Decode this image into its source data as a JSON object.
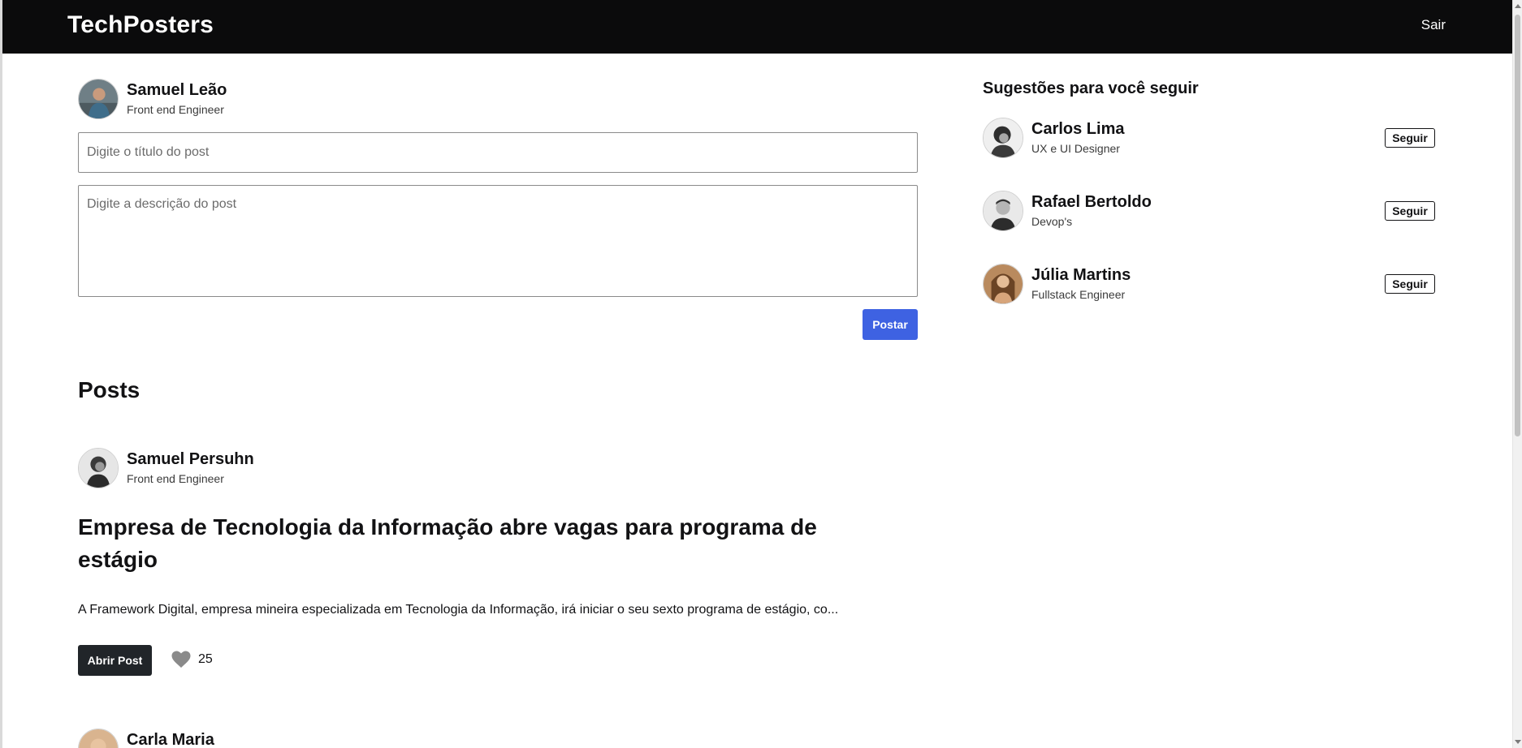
{
  "header": {
    "brand": "TechPosters",
    "logout_label": "Sair"
  },
  "current_user": {
    "name": "Samuel Leão",
    "role": "Front end Engineer"
  },
  "composer": {
    "title_placeholder": "Digite o título do post",
    "description_placeholder": "Digite a descrição do post",
    "submit_label": "Postar"
  },
  "posts": {
    "heading": "Posts",
    "items": [
      {
        "author_name": "Samuel Persuhn",
        "author_role": "Front end Engineer",
        "title": "Empresa de Tecnologia da Informação abre vagas para programa de estágio",
        "excerpt": "A Framework Digital, empresa mineira especializada em Tecnologia da Informação, irá iniciar o seu sexto programa de estágio, co...",
        "open_label": "Abrir Post",
        "likes": "25"
      },
      {
        "author_name": "Carla Maria"
      }
    ]
  },
  "suggestions": {
    "heading": "Sugestões para você seguir",
    "follow_label": "Seguir",
    "items": [
      {
        "name": "Carlos Lima",
        "role": "UX e UI Designer"
      },
      {
        "name": "Rafael Bertoldo",
        "role": "Devop's"
      },
      {
        "name": "Júlia Martins",
        "role": "Fullstack Engineer"
      }
    ]
  },
  "colors": {
    "header_bg": "#0b0b0c",
    "primary_button": "#3e62e2",
    "dark_button": "#212529",
    "like_icon": "#8a8a8a"
  },
  "icons": {
    "like": "heart-icon"
  }
}
